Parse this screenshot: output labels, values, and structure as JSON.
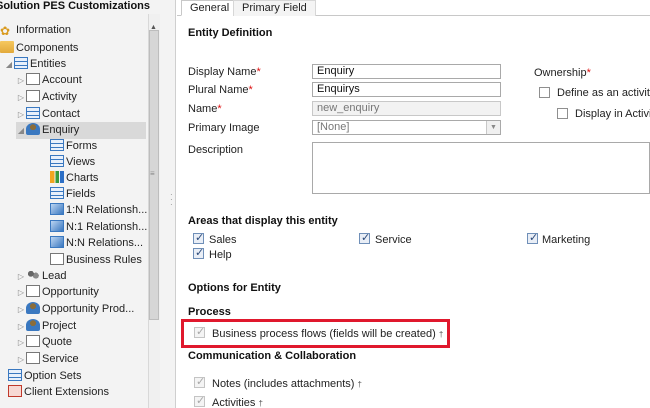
{
  "nav": {
    "title": "Solution PES Customizations",
    "items": [
      {
        "label": "Information",
        "icon": "information-icon"
      },
      {
        "label": "Components",
        "icon": "components-folder-icon"
      },
      {
        "label": "Entities",
        "icon": "entities-icon"
      },
      {
        "label": "Account",
        "icon": "account-icon"
      },
      {
        "label": "Activity",
        "icon": "activity-icon"
      },
      {
        "label": "Contact",
        "icon": "contact-icon"
      },
      {
        "label": "Enquiry",
        "icon": "enquiry-icon"
      },
      {
        "label": "Forms",
        "icon": "forms-icon"
      },
      {
        "label": "Views",
        "icon": "views-icon"
      },
      {
        "label": "Charts",
        "icon": "charts-icon"
      },
      {
        "label": "Fields",
        "icon": "fields-icon"
      },
      {
        "label": "1:N Relationsh...",
        "icon": "one-to-many-icon"
      },
      {
        "label": "N:1 Relationsh...",
        "icon": "many-to-one-icon"
      },
      {
        "label": "N:N Relations...",
        "icon": "many-to-many-icon"
      },
      {
        "label": "Business Rules",
        "icon": "business-rules-icon"
      },
      {
        "label": "Lead",
        "icon": "lead-icon"
      },
      {
        "label": "Opportunity",
        "icon": "opportunity-icon"
      },
      {
        "label": "Opportunity Prod...",
        "icon": "opportunity-product-icon"
      },
      {
        "label": "Project",
        "icon": "project-icon"
      },
      {
        "label": "Quote",
        "icon": "quote-icon"
      },
      {
        "label": "Service",
        "icon": "service-icon"
      },
      {
        "label": "Option Sets",
        "icon": "option-sets-icon"
      },
      {
        "label": "Client Extensions",
        "icon": "client-extensions-icon"
      }
    ]
  },
  "tabs": {
    "general": "General",
    "primary_field": "Primary Field"
  },
  "entity_definition": {
    "title": "Entity Definition",
    "display_name_label": "Display Name",
    "display_name_value": "Enquiry",
    "plural_name_label": "Plural Name",
    "plural_name_value": "Enquirys",
    "name_label": "Name",
    "name_value": "new_enquiry",
    "primary_image_label": "Primary Image",
    "primary_image_value": "[None]",
    "description_label": "Description",
    "required_marker": "*",
    "ownership_label": "Ownership",
    "define_activity_label": "Define as an activity",
    "display_activity_label": "Display in Activit"
  },
  "areas": {
    "title": "Areas that display this entity",
    "sales": "Sales",
    "service": "Service",
    "marketing": "Marketing",
    "help": "Help"
  },
  "options": {
    "title": "Options for Entity",
    "process_title": "Process",
    "business_process_flows": "Business process flows (fields will be created)",
    "communication_title": "Communication & Collaboration",
    "notes": "Notes (includes attachments)",
    "activities": "Activities",
    "dagger": "†"
  },
  "colors": {
    "highlight": "#e0182d",
    "required": "#dd1111"
  }
}
